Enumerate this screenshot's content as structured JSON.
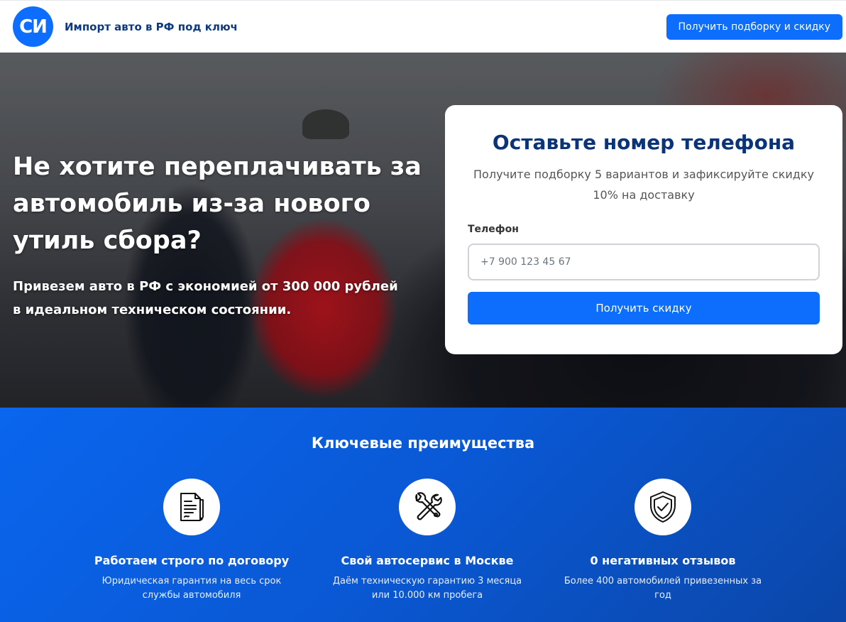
{
  "header": {
    "logo_text": "СИ",
    "brand": "Импорт авто в РФ под ключ",
    "cta": "Получить подборку и скидку"
  },
  "hero": {
    "title": "Не хотите переплачивать за автомобиль из-за нового утиль сбора?",
    "subtitle": "Привезем авто в РФ с экономией от 300 000 рублей в идеальном техническом состоянии."
  },
  "form": {
    "title": "Оставьте номер телефона",
    "subtitle": "Получите подборку 5 вариантов и зафиксируйте скидку 10% на доставку",
    "phone_label": "Телефон",
    "phone_placeholder": "+7 900 123 45 67",
    "phone_value": "",
    "submit": "Получить скидку"
  },
  "advantages": {
    "title": "Ключевые преимущества",
    "items": [
      {
        "icon": "contract-icon",
        "title": "Работаем строго по договору",
        "desc": "Юридическая гарантия на весь срок службы автомобиля"
      },
      {
        "icon": "tools-icon",
        "title": "Свой автосервис в Москве",
        "desc": "Даём техническую гарантию 3 месяца или 10.000 км пробега"
      },
      {
        "icon": "shield-check-icon",
        "title": "0 негативных отзывов",
        "desc": "Более 400 автомобилей привезенных за год"
      }
    ]
  }
}
